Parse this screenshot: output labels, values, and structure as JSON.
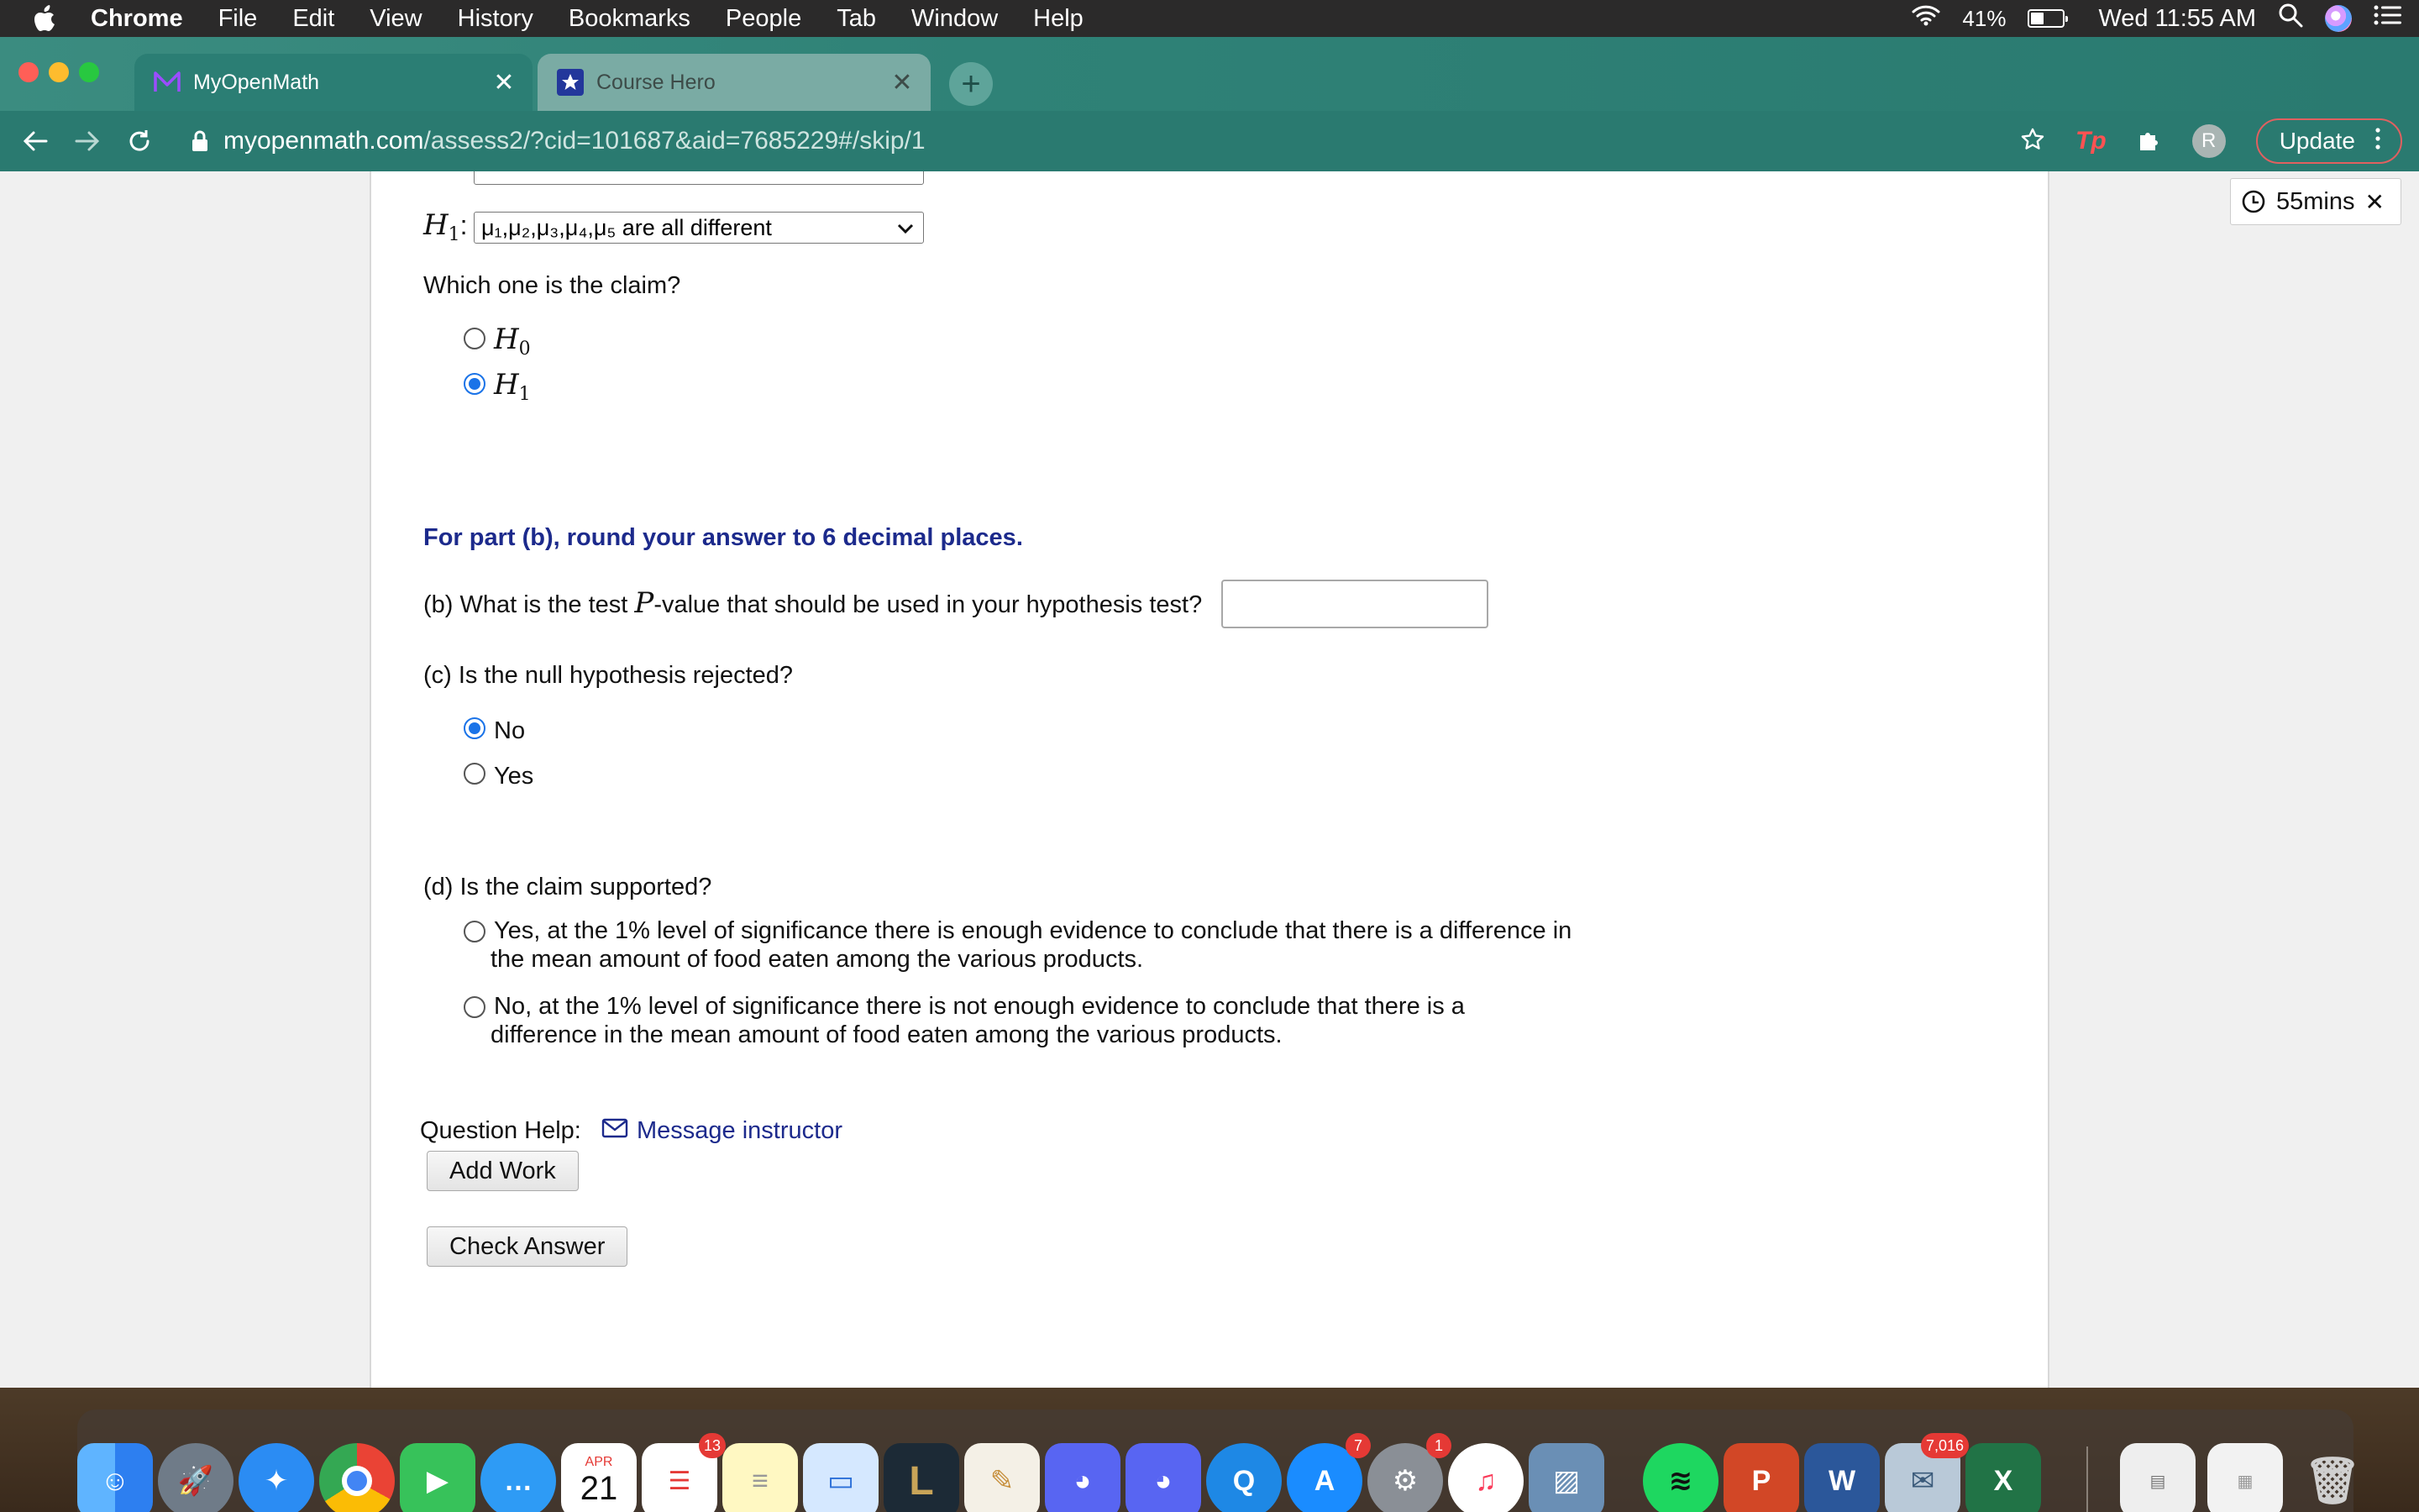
{
  "menubar": {
    "app": "Chrome",
    "items": [
      "File",
      "Edit",
      "View",
      "History",
      "Bookmarks",
      "People",
      "Tab",
      "Window",
      "Help"
    ],
    "battery": "41%",
    "battery_level": 0.41,
    "clock": "Wed 11:55 AM"
  },
  "tabs": [
    {
      "title": "MyOpenMath",
      "active": true
    },
    {
      "title": "Course Hero",
      "active": false
    }
  ],
  "toolbar": {
    "url_host": "myopenmath.com",
    "url_path": "/assess2/?cid=101687&aid=7685229#/skip/1",
    "profile_initial": "R",
    "update_label": "Update"
  },
  "timer": {
    "label": "55mins"
  },
  "question": {
    "h1_symbol": "H",
    "h1_sub": "1",
    "h1_colon": ":",
    "h1_select": "μ₁,μ₂,μ₃,μ₄,μ₅ are all different",
    "claim_prompt": "Which one is the claim?",
    "claim_options": [
      {
        "symbol": "H",
        "sub": "0"
      },
      {
        "symbol": "H",
        "sub": "1"
      }
    ],
    "round_note": "For part (b), round your answer to 6 decimal places.",
    "part_b_before": "(b) What is the test ",
    "part_b_var": "P",
    "part_b_after": "-value that should be used in your hypothesis test?",
    "part_c": "(c) Is the null hypothesis rejected?",
    "part_c_options": [
      "No",
      "Yes"
    ],
    "part_d": "(d) Is the claim supported?",
    "part_d_options": [
      [
        "Yes, at the 1% level of significance there is enough evidence to conclude that there is a difference in",
        "the mean amount of food eaten among the various products."
      ],
      [
        "No, at the 1% level of significance there is not enough evidence to conclude that there is a",
        "difference in the mean amount of food eaten among the various products."
      ]
    ],
    "help_label": "Question Help:",
    "message_link": "Message instructor",
    "add_work": "Add Work",
    "check_answer": "Check Answer"
  },
  "dock": {
    "calendar_month": "APR",
    "calendar_day": "21",
    "badges": {
      "reminders": "13",
      "appstore": "7",
      "settings": "1",
      "mail": "7,016"
    }
  }
}
